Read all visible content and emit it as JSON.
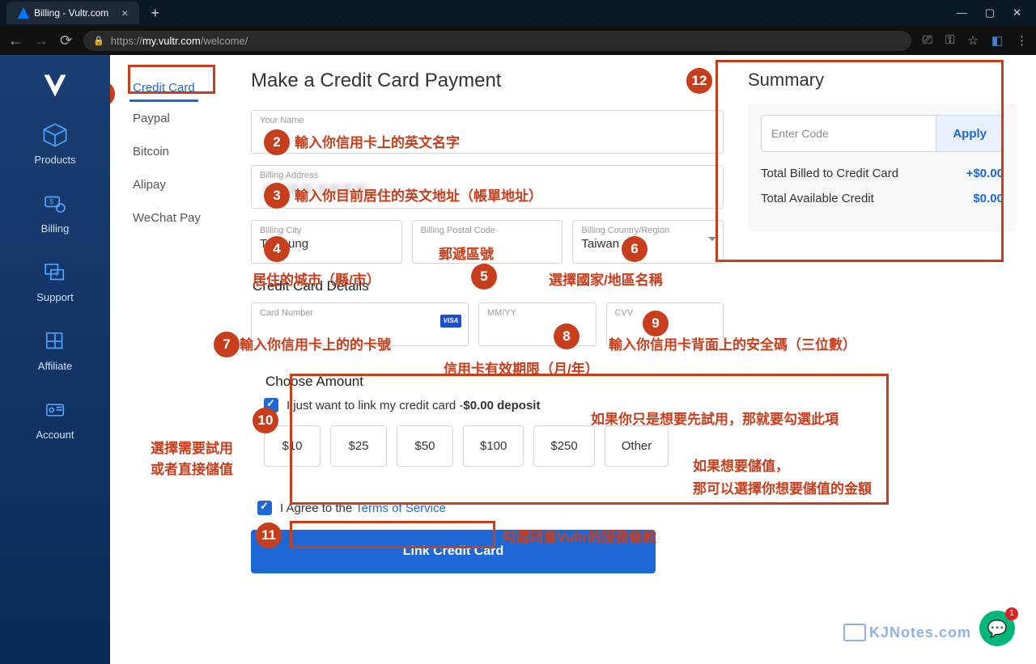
{
  "window": {
    "tab_title": "Billing - Vultr.com"
  },
  "address_bar": {
    "scheme": "https://",
    "domain": "my.vultr.com",
    "path": "/welcome/"
  },
  "sidebar": {
    "items": [
      {
        "label": "Products"
      },
      {
        "label": "Billing"
      },
      {
        "label": "Support"
      },
      {
        "label": "Affiliate"
      },
      {
        "label": "Account"
      }
    ]
  },
  "pay_tabs": [
    "Credit Card",
    "Paypal",
    "Bitcoin",
    "Alipay",
    "WeChat Pay"
  ],
  "form": {
    "title": "Make a Credit Card Payment",
    "name": {
      "label": "Your Name",
      "value": ""
    },
    "address": {
      "label": "Billing Address",
      "value": ""
    },
    "city": {
      "label": "Billing City",
      "value": "Taichung"
    },
    "postal": {
      "label": "Billing Postal Code",
      "value": ""
    },
    "country": {
      "label": "Billing Country/Region",
      "value": "Taiwan"
    },
    "cc_section": "Credit Card Details",
    "cc_number": {
      "label": "Card Number"
    },
    "cc_exp": {
      "label": "MM/YY"
    },
    "cc_cvv": {
      "label": "CVV"
    },
    "amount_section": "Choose Amount",
    "link_only": "I just want to link my credit card -",
    "link_only_amt": "$0.00 deposit",
    "amounts": [
      "$10",
      "$25",
      "$50",
      "$100",
      "$250",
      "Other"
    ],
    "tos_prefix": "I Agree to the ",
    "tos_link": "Terms of Service",
    "submit": "Link Credit Card"
  },
  "summary": {
    "heading": "Summary",
    "code_placeholder": "Enter Code",
    "apply": "Apply",
    "lines": [
      {
        "label": "Total Billed to Credit Card",
        "value": "+$0.00"
      },
      {
        "label": "Total Available Credit",
        "value": "$0.00"
      }
    ]
  },
  "annotations": {
    "1": "",
    "2": "輸入你信用卡上的英文名字",
    "3": "輸入你目前居住的英文地址（帳單地址）",
    "4": "居住的城市（縣/市）",
    "5": "郵遞區號",
    "6": "選擇國家/地區名稱",
    "7": "輸入你信用卡上的的卡號",
    "8": "信用卡有效期限（月/年）",
    "9": "輸入你信用卡背面上的安全碼（三位數）",
    "10a": "選擇需要試用",
    "10b": "或者直接儲值",
    "10c": "如果你只是想要先試用，那就要勾選此項",
    "10d": "如果想要儲值，",
    "10e": "那可以選擇你想要儲值的金額",
    "11": "勾選同意Vultr的服務條款",
    "12": ""
  },
  "chat_badge": "1",
  "watermark": "KJNotes.com"
}
